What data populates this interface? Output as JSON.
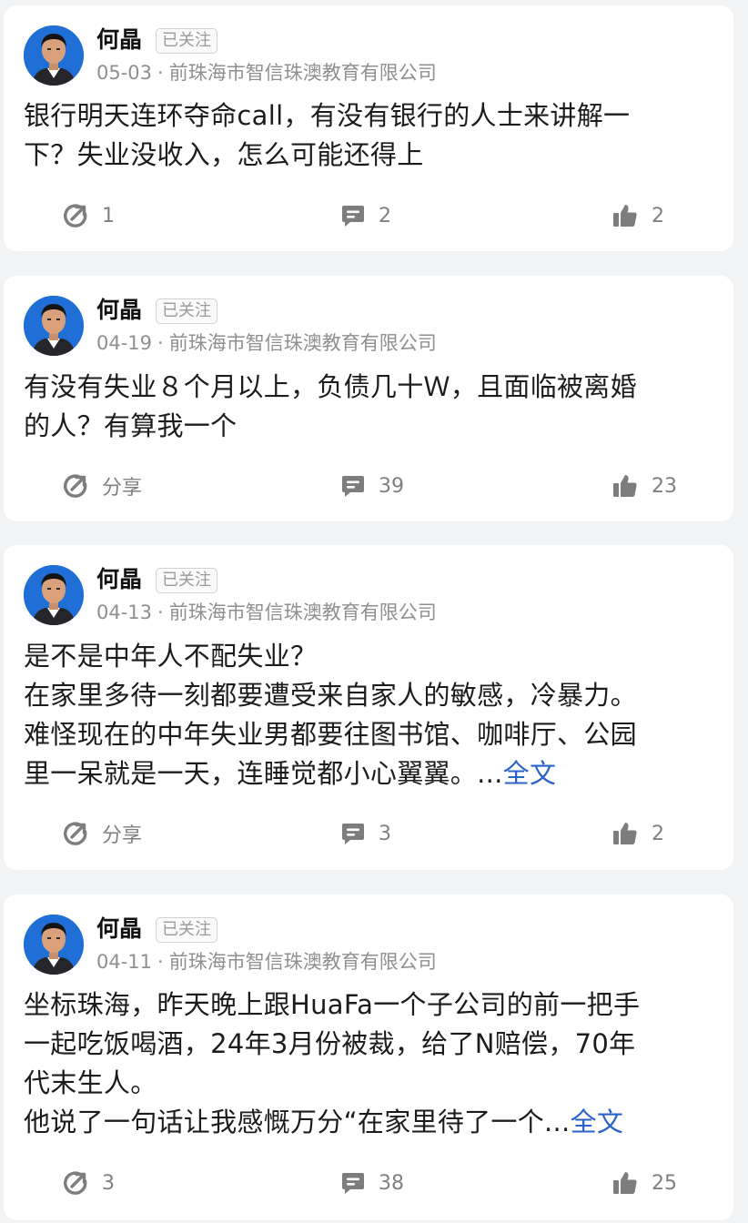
{
  "colors": {
    "background": "#f2f3f5",
    "card": "#ffffff",
    "link": "#2b63c8",
    "muted": "#8f8f8f",
    "avatar_bg": "#1f6fd6"
  },
  "icons": {
    "share": "share-icon",
    "comment": "comment-icon",
    "like": "thumbs-up-icon"
  },
  "posts": [
    {
      "author": "何晶",
      "follow_status": "已关注",
      "date": "05-03",
      "separator": "·",
      "company": "前珠海市智信珠澳教育有限公司",
      "lines": [
        "银行明天连环夺命call，有没有银行的人士来讲解一",
        "下？失业没收入，怎么可能还得上"
      ],
      "more": "",
      "share": "1",
      "comments": "2",
      "likes": "2"
    },
    {
      "author": "何晶",
      "follow_status": "已关注",
      "date": "04-19",
      "separator": "·",
      "company": "前珠海市智信珠澳教育有限公司",
      "lines": [
        "有没有失业８个月以上，负债几十Ｗ，且面临被离婚",
        "的人？有算我一个"
      ],
      "more": "",
      "share": "分享",
      "comments": "39",
      "likes": "23"
    },
    {
      "author": "何晶",
      "follow_status": "已关注",
      "date": "04-13",
      "separator": "·",
      "company": "前珠海市智信珠澳教育有限公司",
      "lines": [
        "是不是中年人不配失业？",
        "在家里多待一刻都要遭受来自家人的敏感，冷暴力。",
        "难怪现在的中年失业男都要往图书馆、咖啡厅、公园",
        "里一呆就是一天，连睡觉都小心翼翼。..."
      ],
      "more": "全文",
      "share": "分享",
      "comments": "3",
      "likes": "2"
    },
    {
      "author": "何晶",
      "follow_status": "已关注",
      "date": "04-11",
      "separator": "·",
      "company": "前珠海市智信珠澳教育有限公司",
      "lines": [
        "坐标珠海，昨天晚上跟HuaFa一个子公司的前一把手",
        "一起吃饭喝酒，24年3月份被裁，给了N赔偿，70年",
        "代末生人。",
        "他说了一句话让我感慨万分“在家里待了一个..."
      ],
      "more": "全文",
      "share": "3",
      "comments": "38",
      "likes": "25"
    }
  ]
}
